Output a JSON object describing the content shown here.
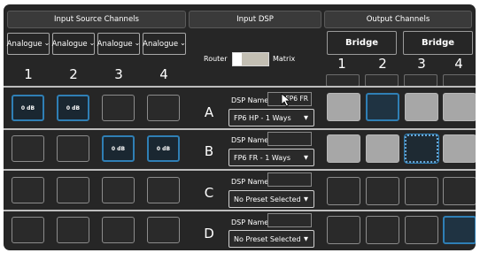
{
  "headers": {
    "input_source": "Input Source Channels",
    "input_dsp": "Input DSP",
    "output": "Output Channels"
  },
  "input_selects": [
    {
      "label": "Analogue"
    },
    {
      "label": "Analogue"
    },
    {
      "label": "Analogue"
    },
    {
      "label": "Analogue"
    }
  ],
  "input_numbers": [
    "1",
    "2",
    "3",
    "4"
  ],
  "router_toggle": {
    "left_label": "Router",
    "right_label": "Matrix",
    "state": "router"
  },
  "bridge_buttons": [
    "Bridge",
    "Bridge"
  ],
  "output_numbers": [
    "1",
    "2",
    "3",
    "4"
  ],
  "rows": [
    {
      "letter": "A",
      "inputs": [
        {
          "label": "0 dB",
          "active": true
        },
        {
          "label": "0 dB",
          "active": true
        },
        {
          "label": "",
          "active": false
        },
        {
          "label": "",
          "active": false
        }
      ],
      "dsp_name_label": "DSP Name",
      "dsp_name_value": "FP6 FR",
      "preset": "FP6 HP - 1 Ways",
      "outputs": [
        "gray",
        "blue",
        "gray",
        "gray"
      ]
    },
    {
      "letter": "B",
      "inputs": [
        {
          "label": "",
          "active": false
        },
        {
          "label": "",
          "active": false
        },
        {
          "label": "0 dB",
          "active": true
        },
        {
          "label": "0 dB",
          "active": true
        }
      ],
      "dsp_name_label": "DSP Name",
      "dsp_name_value": "",
      "preset": "FP6 FR - 1 Ways",
      "outputs": [
        "gray",
        "gray",
        "dotted",
        "gray"
      ]
    },
    {
      "letter": "C",
      "inputs": [
        {
          "label": "",
          "active": false
        },
        {
          "label": "",
          "active": false
        },
        {
          "label": "",
          "active": false
        },
        {
          "label": "",
          "active": false
        }
      ],
      "dsp_name_label": "DSP Name",
      "dsp_name_value": "",
      "preset": "No Preset Selected",
      "outputs": [
        "dark",
        "dark",
        "dark",
        "dark"
      ]
    },
    {
      "letter": "D",
      "inputs": [
        {
          "label": "",
          "active": false
        },
        {
          "label": "",
          "active": false
        },
        {
          "label": "",
          "active": false
        },
        {
          "label": "",
          "active": false
        }
      ],
      "dsp_name_label": "DSP Name",
      "dsp_name_value": "",
      "preset": "No Preset Selected",
      "outputs": [
        "dark",
        "dark",
        "dark",
        "blue"
      ]
    }
  ],
  "icons": {
    "select_chevron": "chevron-down-icon",
    "preset_arrow": "caret-down-icon",
    "pointer": "mouse-pointer-icon"
  },
  "colors": {
    "panel": "#262626",
    "active_blue": "#2f7fb5",
    "output_gray": "#a7a7a7",
    "toggle_track": "#c3bfb3"
  }
}
